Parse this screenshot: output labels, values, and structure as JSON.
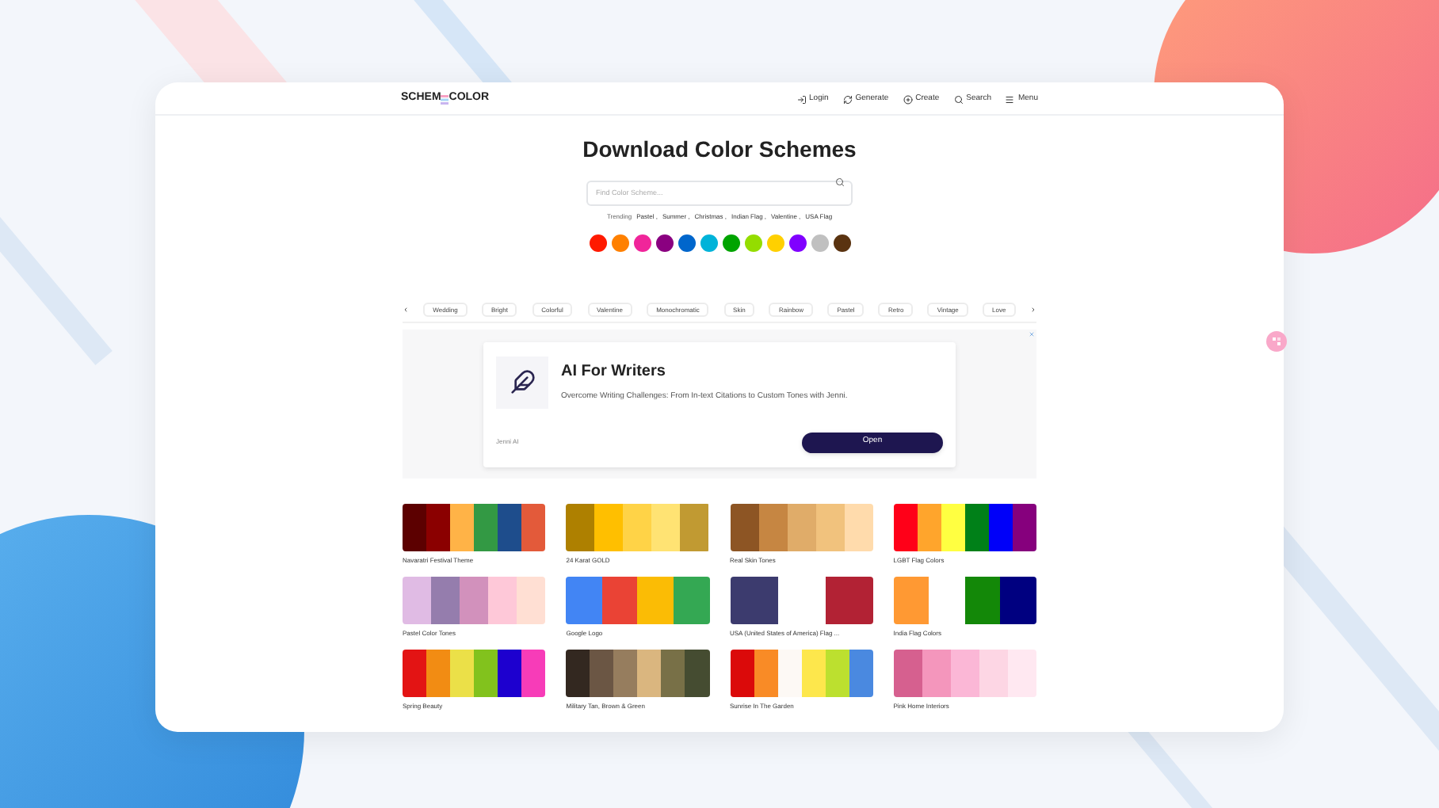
{
  "header": {
    "logo_left": "SCHEM",
    "logo_right": "COLOR",
    "nav": [
      {
        "kind": "login",
        "label": "Login"
      },
      {
        "kind": "generate",
        "label": "Generate"
      },
      {
        "kind": "create",
        "label": "Create"
      },
      {
        "kind": "search",
        "label": "Search"
      },
      {
        "kind": "menu",
        "label": "Menu"
      }
    ]
  },
  "title": "Download Color Schemes",
  "search": {
    "placeholder": "Find Color Scheme..."
  },
  "trending": {
    "label": "Trending",
    "items": [
      "Pastel ,",
      "Summer ,",
      "Christmas ,",
      "Indian Flag ,",
      "Valentine ,",
      "USA Flag"
    ]
  },
  "color_filters": [
    {
      "color": "#ff1a00"
    },
    {
      "color": "#ff8000"
    },
    {
      "color": "#f0259a"
    },
    {
      "color": "#8a0080"
    },
    {
      "color": "#0066cc"
    },
    {
      "color": "#00b3d9"
    },
    {
      "color": "#00a400"
    },
    {
      "color": "#94dd00"
    },
    {
      "color": "#ffd000"
    },
    {
      "color": "#8000ff"
    },
    {
      "color": "#c0c0c0"
    },
    {
      "color": "#5a3310"
    }
  ],
  "tags": [
    "Wedding",
    "Bright",
    "Colorful",
    "Valentine",
    "Monochromatic",
    "Skin",
    "Rainbow",
    "Pastel",
    "Retro",
    "Vintage",
    "Love"
  ],
  "ad": {
    "title": "AI For Writers",
    "text": "Overcome Writing Challenges: From In-text Citations to Custom Tones with Jenni.",
    "advertiser": "Jenni AI",
    "button": "Open"
  },
  "schemes": [
    {
      "name": "Navaratri Festival Theme",
      "colors": [
        {
          "color": "#5c0000"
        },
        {
          "color": "#8b0000"
        },
        {
          "color": "#ffb347"
        },
        {
          "color": "#339944"
        },
        {
          "color": "#1e4d8c"
        },
        {
          "color": "#e35a3a"
        }
      ]
    },
    {
      "name": "24 Karat GOLD",
      "colors": [
        {
          "color": "#ae8000"
        },
        {
          "color": "#ffbf00"
        },
        {
          "color": "#ffd347"
        },
        {
          "color": "#ffe373"
        },
        {
          "color": "#c19a32"
        }
      ]
    },
    {
      "name": "Real Skin Tones",
      "colors": [
        {
          "color": "#8d5524"
        },
        {
          "color": "#c68642"
        },
        {
          "color": "#e0ac69"
        },
        {
          "color": "#f1c27d"
        },
        {
          "color": "#ffdbac"
        }
      ]
    },
    {
      "name": "LGBT Flag Colors",
      "colors": [
        {
          "color": "#ff0018"
        },
        {
          "color": "#ffa52c"
        },
        {
          "color": "#ffff41"
        },
        {
          "color": "#008018"
        },
        {
          "color": "#0000f9"
        },
        {
          "color": "#86007d"
        }
      ]
    },
    {
      "name": "Pastel Color Tones",
      "colors": [
        {
          "color": "#e0bbe4"
        },
        {
          "color": "#957dad"
        },
        {
          "color": "#d291bc"
        },
        {
          "color": "#fec8d8"
        },
        {
          "color": "#ffdfd3"
        }
      ]
    },
    {
      "name": "Google Logo",
      "colors": [
        {
          "color": "#4285f4"
        },
        {
          "color": "#ea4335"
        },
        {
          "color": "#fbbc05"
        },
        {
          "color": "#34a853"
        }
      ]
    },
    {
      "name": "USA (United States of America) Flag ...",
      "colors": [
        {
          "color": "#3c3b6e"
        },
        {
          "color": "#ffffff"
        },
        {
          "color": "#b22234"
        }
      ]
    },
    {
      "name": "India Flag Colors",
      "colors": [
        {
          "color": "#ff9933"
        },
        {
          "color": "#ffffff"
        },
        {
          "color": "#138808"
        },
        {
          "color": "#000080"
        }
      ]
    },
    {
      "name": "Spring Beauty",
      "colors": [
        {
          "color": "#e31414"
        },
        {
          "color": "#f28c13"
        },
        {
          "color": "#ebe048"
        },
        {
          "color": "#82c21d"
        },
        {
          "color": "#1d00cf"
        },
        {
          "color": "#f73cb8"
        }
      ]
    },
    {
      "name": "Military Tan, Brown & Green",
      "colors": [
        {
          "color": "#332820"
        },
        {
          "color": "#6b5644"
        },
        {
          "color": "#967d5e"
        },
        {
          "color": "#dab67f"
        },
        {
          "color": "#787047"
        },
        {
          "color": "#454c31"
        }
      ]
    },
    {
      "name": "Sunrise In The Garden",
      "colors": [
        {
          "color": "#db0a0a"
        },
        {
          "color": "#f98b26"
        },
        {
          "color": "#fdf9f5"
        },
        {
          "color": "#fde74c"
        },
        {
          "color": "#bce02f"
        },
        {
          "color": "#4a89e0"
        }
      ]
    },
    {
      "name": "Pink Home Interiors",
      "colors": [
        {
          "color": "#d6608f"
        },
        {
          "color": "#f496bc"
        },
        {
          "color": "#fbb7d6"
        },
        {
          "color": "#fdd6e4"
        },
        {
          "color": "#ffe8f1"
        }
      ]
    }
  ]
}
